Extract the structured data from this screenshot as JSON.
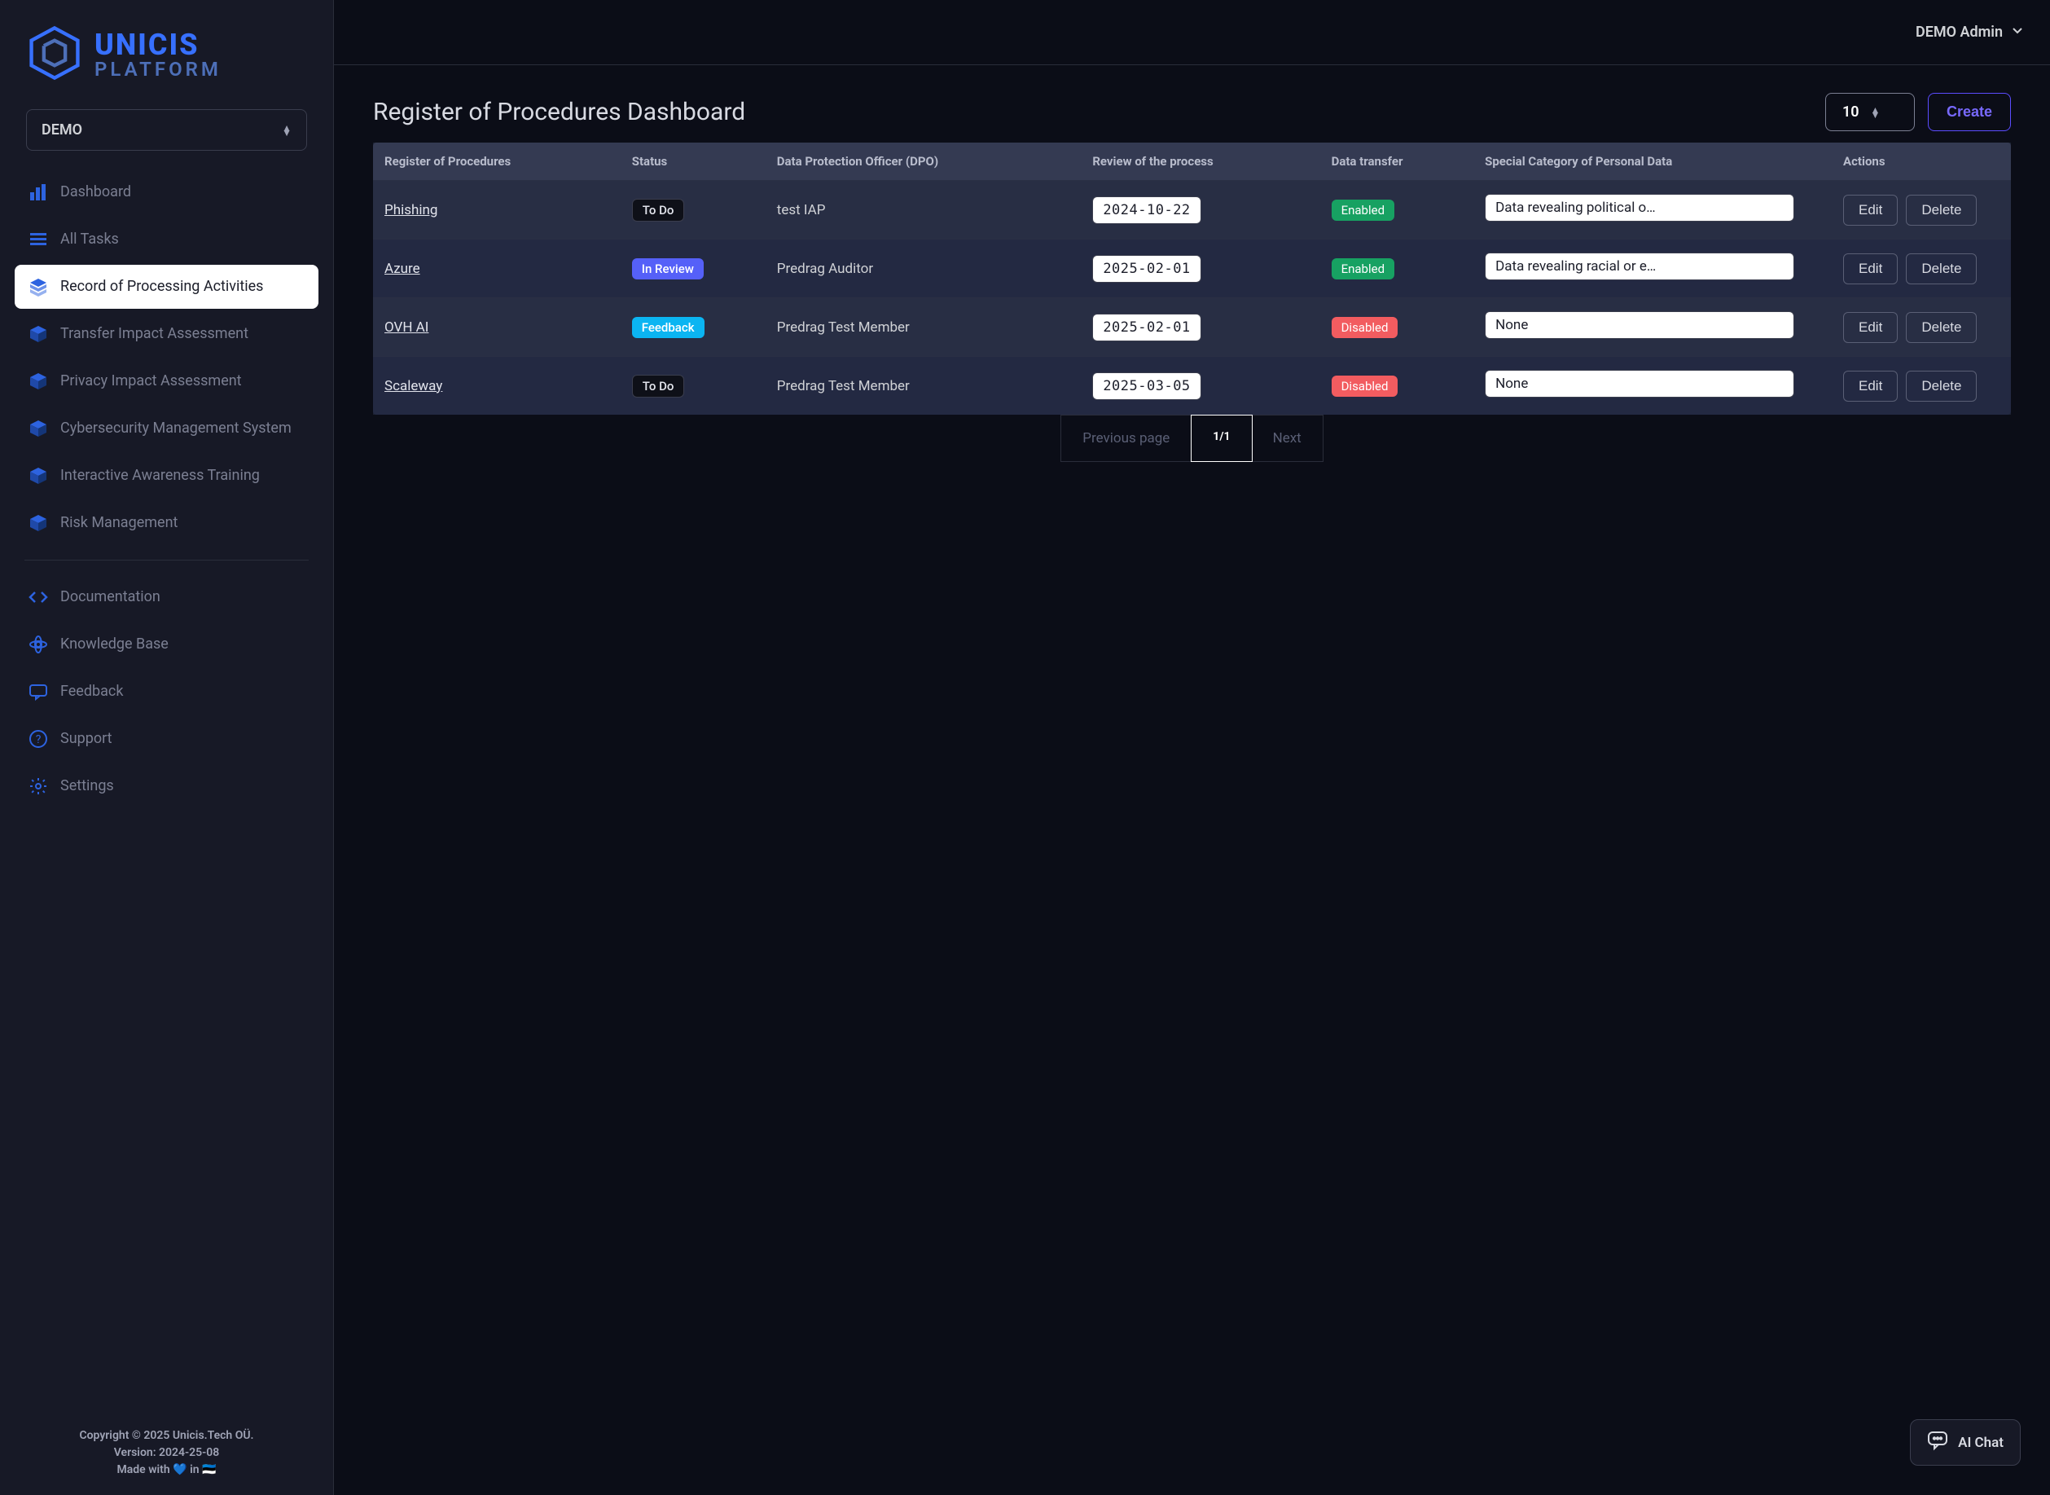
{
  "brand": {
    "line1": "UNICIS",
    "line2": "PLATFORM"
  },
  "team_select": "DEMO",
  "header": {
    "user": "DEMO Admin"
  },
  "sidebar": {
    "items": [
      {
        "label": "Dashboard"
      },
      {
        "label": "All Tasks"
      },
      {
        "label": "Record of Processing Activities"
      },
      {
        "label": "Transfer Impact Assessment"
      },
      {
        "label": "Privacy Impact Assessment"
      },
      {
        "label": "Cybersecurity Management System"
      },
      {
        "label": "Interactive Awareness Training"
      },
      {
        "label": "Risk Management"
      }
    ],
    "items2": [
      {
        "label": "Documentation"
      },
      {
        "label": "Knowledge Base"
      },
      {
        "label": "Feedback"
      },
      {
        "label": "Support"
      },
      {
        "label": "Settings"
      }
    ]
  },
  "footer": {
    "copyright": "Copyright © 2025 Unicis.Tech OÜ.",
    "version": "Version: 2024-25-08",
    "madewith": "Made with 💙 in 🇪🇪"
  },
  "page": {
    "title": "Register of Procedures Dashboard",
    "pagesize": "10",
    "create": "Create"
  },
  "columns": {
    "c0": "Register of Procedures",
    "c1": "Status",
    "c2": "Data Protection Officer (DPO)",
    "c3": "Review of the process",
    "c4": "Data transfer",
    "c5": "Special Category of Personal Data",
    "c6": "Actions"
  },
  "status_labels": {
    "todo": "To Do",
    "inreview": "In Review",
    "feedback": "Feedback"
  },
  "transfer_labels": {
    "enabled": "Enabled",
    "disabled": "Disabled"
  },
  "action_labels": {
    "edit": "Edit",
    "delete": "Delete"
  },
  "rows": [
    {
      "name": "Phishing",
      "status": "todo",
      "dpo": "test IAP",
      "review": "2024-10-22",
      "transfer": "enabled",
      "special": "Data revealing political o…"
    },
    {
      "name": "Azure",
      "status": "inreview",
      "dpo": "Predrag Auditor",
      "review": "2025-02-01",
      "transfer": "enabled",
      "special": "Data revealing racial or e…"
    },
    {
      "name": "OVH AI",
      "status": "feedback",
      "dpo": "Predrag Test Member",
      "review": "2025-02-01",
      "transfer": "disabled",
      "special": "None"
    },
    {
      "name": "Scaleway",
      "status": "todo",
      "dpo": "Predrag Test Member",
      "review": "2025-03-05",
      "transfer": "disabled",
      "special": "None"
    }
  ],
  "pager": {
    "prev": "Previous page",
    "current": "1/1",
    "next": "Next"
  },
  "ai_chat": "AI Chat"
}
